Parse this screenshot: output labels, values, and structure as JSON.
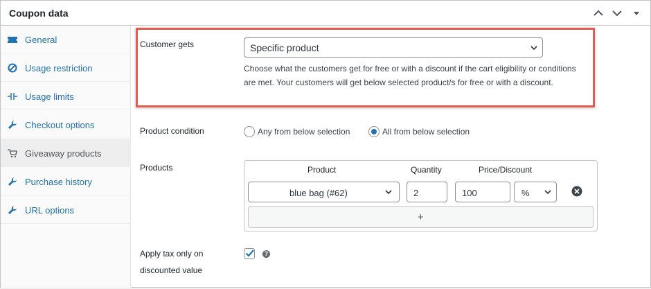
{
  "panel": {
    "title": "Coupon data"
  },
  "header_icons": [
    "chevron-up-icon",
    "chevron-down-icon",
    "caret-down-icon"
  ],
  "sidebar": {
    "items": [
      {
        "label": "General",
        "icon": "ticket-icon"
      },
      {
        "label": "Usage restriction",
        "icon": "block-icon"
      },
      {
        "label": "Usage limits",
        "icon": "limits-icon"
      },
      {
        "label": "Checkout options",
        "icon": "wrench-icon"
      },
      {
        "label": "Giveaway products",
        "icon": "cart-icon",
        "active": true
      },
      {
        "label": "Purchase history",
        "icon": "wrench-icon"
      },
      {
        "label": "URL options",
        "icon": "wrench-icon"
      }
    ]
  },
  "customer_gets": {
    "label": "Customer gets",
    "value": "Specific product",
    "description": "Choose what the customers get for free or with a discount if the cart eligibility or conditions are met. Your customers will get below selected product/s for free or with a discount."
  },
  "product_condition": {
    "label": "Product condition",
    "options": [
      {
        "label": "Any from below selection",
        "checked": false
      },
      {
        "label": "All from below selection",
        "checked": true
      }
    ]
  },
  "products": {
    "label": "Products",
    "columns": [
      "Product",
      "Quantity",
      "Price/Discount"
    ],
    "rows": [
      {
        "product": "blue bag (#62)",
        "quantity": "2",
        "price": "100",
        "discount_type": "%"
      }
    ],
    "add_label": "+"
  },
  "apply_tax": {
    "label_line1": "Apply tax only on",
    "label_line2": "discounted value",
    "checked": true,
    "help": "?"
  },
  "colors": {
    "accent": "#2271b1",
    "highlight": "#e45b4f",
    "border": "#c3c4c7"
  }
}
